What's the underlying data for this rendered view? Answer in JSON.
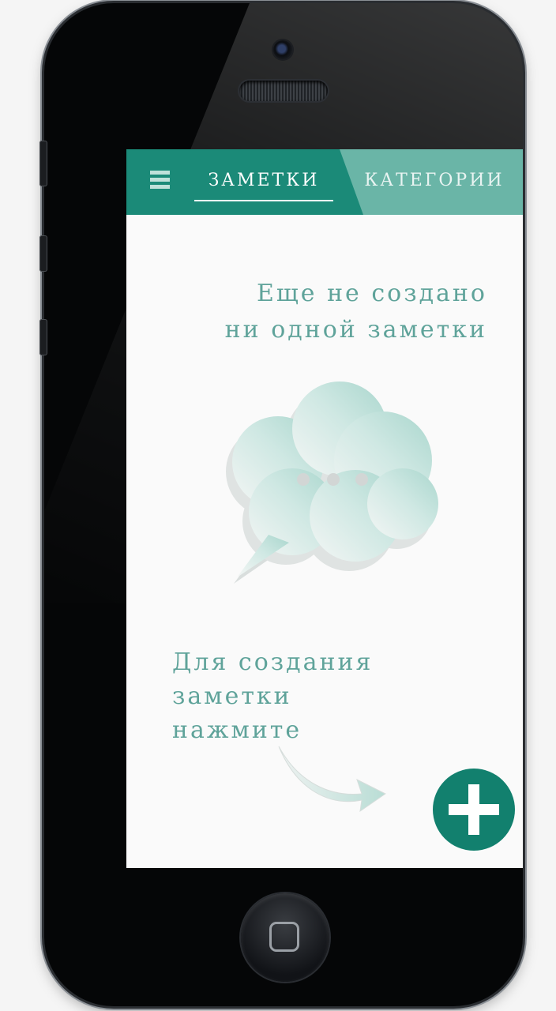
{
  "tabs": {
    "notes": "ЗАМЕТКИ",
    "categories": "КАТЕГОРИИ"
  },
  "empty_state": {
    "line1": "Еще не создано",
    "line2": "ни одной заметки"
  },
  "hint": {
    "line1": "Для создания",
    "line2": "заметки",
    "line3": "нажмите"
  },
  "icons": {
    "menu": "hamburger-menu-icon",
    "bubble": "speech-bubble-icon",
    "arrow": "curved-arrow-icon",
    "add": "plus-icon"
  },
  "colors": {
    "primary": "#1b8a78",
    "primary_light": "#6ab5a7",
    "text_accent": "#5fa39a",
    "fab": "#12806e"
  }
}
